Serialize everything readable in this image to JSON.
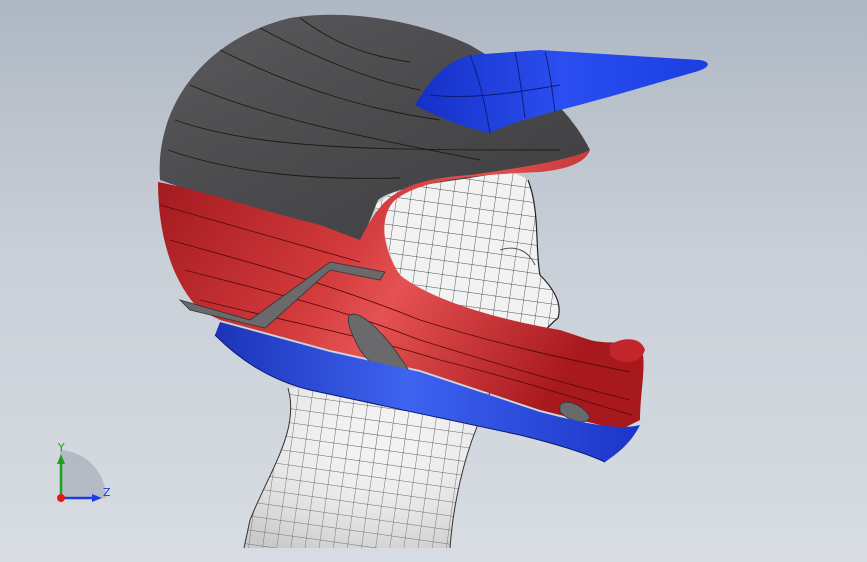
{
  "viewport": {
    "background_top": "#aeb7c3",
    "background_bottom": "#d8dde3"
  },
  "model": {
    "name_icon": "full-face-motocross-helmet-on-mannequin-head",
    "colors": {
      "shell_gray": "#4a4a4c",
      "stripe_red": "#b11c22",
      "stripe_red_light": "#e0484a",
      "trim_blue": "#1f3fd1",
      "visor_blue": "#1f3fd1",
      "mannequin_white": "#f0f0f0",
      "mesh_lines": "#1a1a1a"
    }
  },
  "triad": {
    "y_label": "Y",
    "z_label": "Z",
    "y_color": "#1aa31a",
    "z_color": "#1a3ee0",
    "x_color": "#e01a1a"
  }
}
